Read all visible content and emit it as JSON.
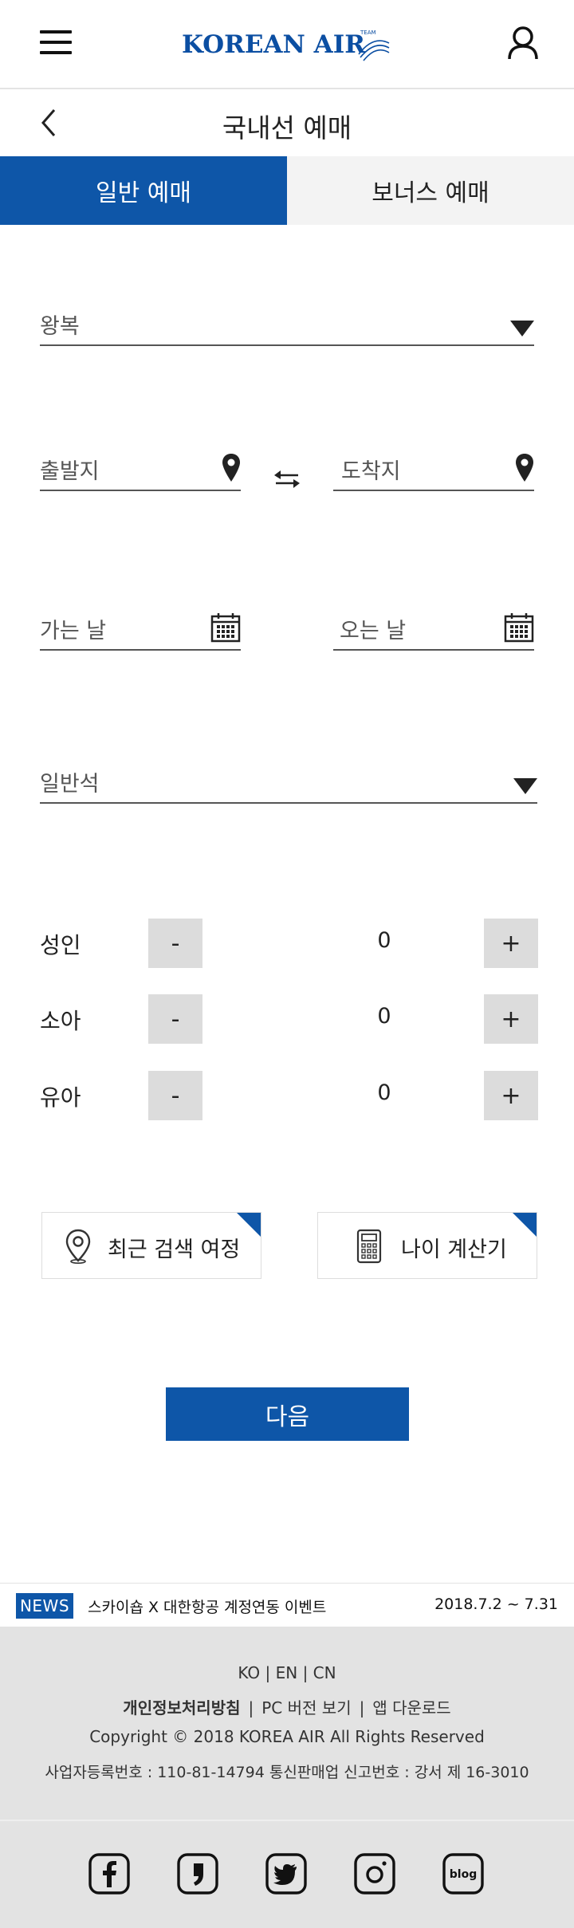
{
  "header": {
    "logo_text": "KOREAN AIR",
    "logo_mark_text": "TEAM"
  },
  "titlebar": {
    "title": "국내선 예매"
  },
  "tabs": [
    {
      "label": "일반 예매",
      "active": true
    },
    {
      "label": "보너스  예매",
      "active": false
    }
  ],
  "form": {
    "trip_type": "왕복",
    "origin_placeholder": "출발지",
    "destination_placeholder": "도착지",
    "depart_date_placeholder": "가는 날",
    "return_date_placeholder": "오는 날",
    "cabin_class": "일반석"
  },
  "passengers": [
    {
      "label": "성인",
      "count": "0",
      "minus": "-",
      "plus": "+"
    },
    {
      "label": "소아",
      "count": "0",
      "minus": "-",
      "plus": "+"
    },
    {
      "label": "유아",
      "count": "0",
      "minus": "-",
      "plus": "+"
    }
  ],
  "tools": {
    "recent_search": "최근 검색 여정",
    "age_calculator": "나이 계산기"
  },
  "next_button": "다음",
  "news": {
    "badge": "NEWS",
    "title": "스카이숍 X 대한항공 계정연동 이벤트",
    "date": "2018.7.2 ~ 7.31"
  },
  "footer": {
    "languages": "KO | EN | CN",
    "privacy": "개인정보처리방침",
    "pc_version": "PC 버전 보기",
    "app_download": "앱 다운로드",
    "link_separator": "|",
    "copyright": "Copyright © 2018 KOREA AIR All Rights Reserved",
    "business_info": "사업자등록번호 : 110-81-14794 통신판매업 신고번호 : 강서 제 16-3010",
    "social": [
      "facebook-icon",
      "kakao-story-icon",
      "twitter-icon",
      "instagram-icon",
      "blog-icon"
    ],
    "blog_label": "blog"
  },
  "colors": {
    "brand_blue": "#0e56a8",
    "tab_inactive": "#f3f3f3",
    "counter_button": "#dcdcdc",
    "footer_bg": "#e3e3e3"
  }
}
